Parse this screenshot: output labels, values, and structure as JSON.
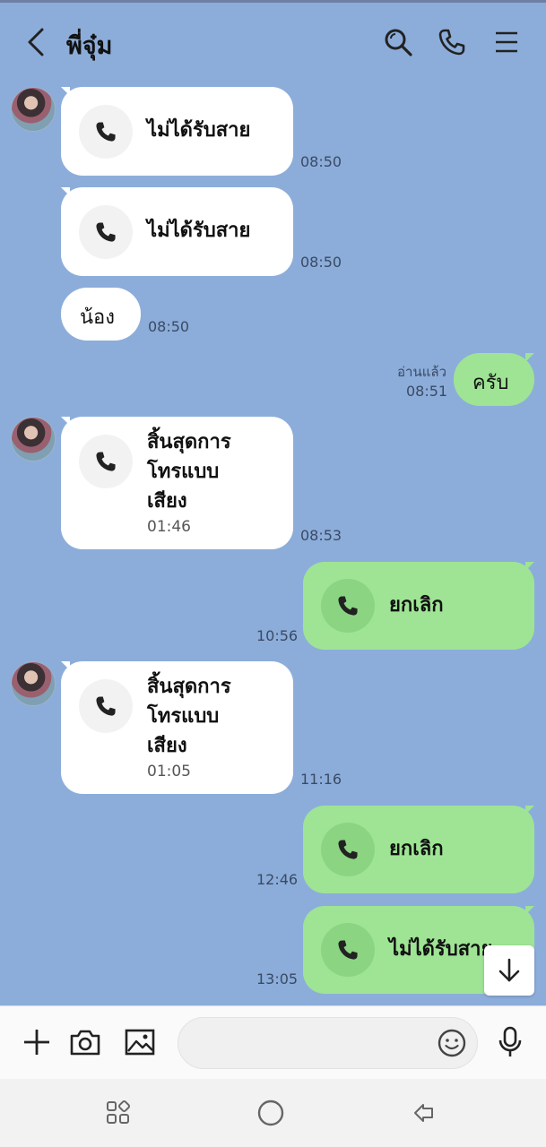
{
  "header": {
    "title": "พี่จุ๋ม"
  },
  "messages": {
    "m1": {
      "text": "ไม่ได้รับสาย",
      "time": "08:50"
    },
    "m2": {
      "text": "ไม่ได้รับสาย",
      "time": "08:50"
    },
    "m3": {
      "text": "น้อง",
      "time": "08:50"
    },
    "m4": {
      "text": "ครับ",
      "time": "08:51",
      "read": "อ่านแล้ว"
    },
    "m5": {
      "line1": "สิ้นสุดการ",
      "line2": "โทรแบบ",
      "line3": "เสียง",
      "duration": "01:46",
      "time": "08:53"
    },
    "m6": {
      "text": "ยกเลิก",
      "time": "10:56"
    },
    "m7": {
      "line1": "สิ้นสุดการ",
      "line2": "โทรแบบ",
      "line3": "เสียง",
      "duration": "01:05",
      "time": "11:16"
    },
    "m8": {
      "text": "ยกเลิก",
      "time": "12:46"
    },
    "m9": {
      "text": "ไม่ได้รับสาย",
      "time": "13:05"
    }
  },
  "input": {
    "placeholder": ""
  },
  "icons": {
    "back": "back-arrow-icon",
    "search": "search-icon",
    "call": "phone-icon",
    "menu": "menu-icon",
    "add": "plus-icon",
    "camera": "camera-icon",
    "gallery": "image-icon",
    "emoji": "emoji-icon",
    "mic": "microphone-icon",
    "scroll": "arrow-down-icon"
  },
  "colors": {
    "background": "#8cadda",
    "incoming": "#ffffff",
    "outgoing": "#9ee494",
    "call_circle_out": "#8bd482"
  }
}
